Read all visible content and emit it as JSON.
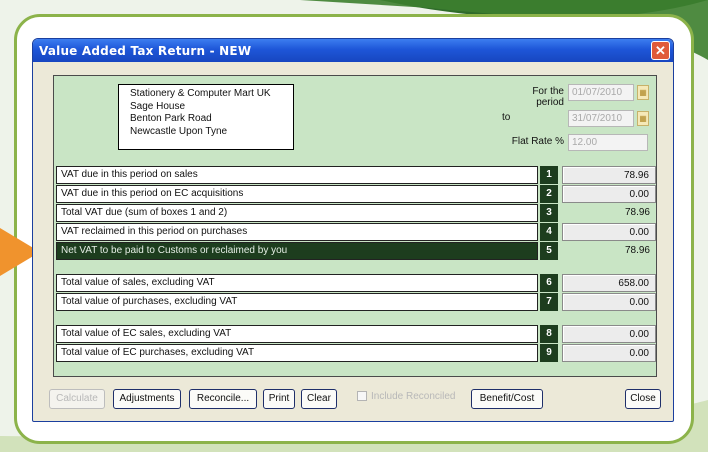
{
  "window": {
    "title": "Value Added Tax Return - NEW",
    "close_glyph": "✕"
  },
  "address": {
    "lines": [
      "Stationery & Computer Mart UK",
      "Sage House",
      "Benton Park Road",
      "Newcastle Upon Tyne"
    ]
  },
  "period": {
    "from_label": "For the period",
    "from_value": "01/07/2010",
    "to_label": "to",
    "to_value": "31/07/2010",
    "flat_rate_label": "Flat Rate %",
    "flat_rate_value": "12.00"
  },
  "rows": [
    {
      "label": "VAT due in this period on sales",
      "box": "1",
      "value": "78.96"
    },
    {
      "label": "VAT due in this period on EC acquisitions",
      "box": "2",
      "value": "0.00"
    },
    {
      "label": "Total VAT due (sum of boxes 1 and 2)",
      "box": "3",
      "value": "78.96"
    },
    {
      "label": "VAT reclaimed in this period on purchases",
      "box": "4",
      "value": "0.00"
    },
    {
      "label": "Net VAT to be paid to Customs or reclaimed by you",
      "box": "5",
      "value": "78.96"
    },
    {
      "label": "Total value of sales, excluding VAT",
      "box": "6",
      "value": "658.00"
    },
    {
      "label": "Total value of purchases, excluding VAT",
      "box": "7",
      "value": "0.00"
    },
    {
      "label": "Total value of EC sales, excluding VAT",
      "box": "8",
      "value": "0.00"
    },
    {
      "label": "Total value of EC purchases, excluding VAT",
      "box": "9",
      "value": "0.00"
    }
  ],
  "buttons": {
    "calculate": "Calculate",
    "adjustments": "Adjustments",
    "reconcile": "Reconcile...",
    "print": "Print",
    "clear": "Clear",
    "include_reconciled": "Include Reconciled",
    "benefit_cost": "Benefit/Cost",
    "close": "Close"
  },
  "colors": {
    "frame": "#8cb34a",
    "arrow": "#f0932d",
    "panel": "#c9e5c5",
    "box_bg": "#1d3d1e"
  }
}
